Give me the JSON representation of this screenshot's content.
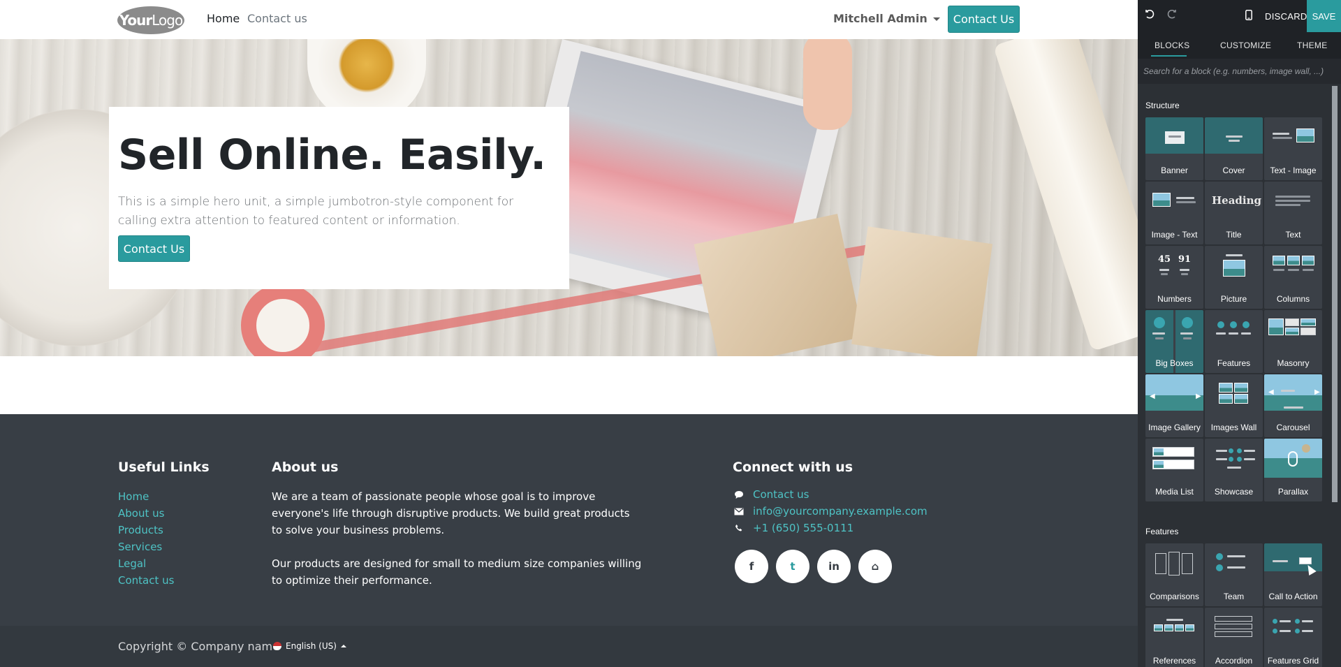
{
  "header": {
    "logo_text_bold": "Your",
    "logo_text_light": "Logo",
    "nav": [
      "Home",
      "Contact us"
    ],
    "user_name": "Mitchell Admin",
    "cta_label": "Contact Us"
  },
  "hero": {
    "title": "Sell Online. Easily.",
    "text": "This is a simple hero unit, a simple jumbotron-style component for calling extra attention to featured content or information.",
    "button_label": "Contact Us"
  },
  "footer": {
    "links_heading": "Useful Links",
    "links": [
      "Home",
      "About us",
      "Products",
      "Services",
      "Legal",
      "Contact us"
    ],
    "about_heading": "About us",
    "about_p1": "We are a team of passionate people whose goal is to improve everyone's life through disruptive products. We build great products to solve your business problems.",
    "about_p2": "Our products are designed for small to medium size companies willing to optimize their performance.",
    "connect_heading": "Connect with us",
    "contacts": [
      "Contact us",
      "info@yourcompany.example.com",
      "+1 (650) 555-0111"
    ],
    "contact_icons": [
      "comment-icon",
      "envelope-icon",
      "phone-icon"
    ],
    "social_icons": [
      "facebook-icon",
      "twitter-icon",
      "linkedin-icon",
      "home-icon"
    ],
    "social_glyphs": [
      "f",
      "t",
      "in",
      "⌂"
    ],
    "copyright": "Copyright © Company name",
    "language": "English (US)"
  },
  "editor": {
    "discard_label": "DISCARD",
    "save_label": "SAVE",
    "tabs": [
      "BLOCKS",
      "CUSTOMIZE",
      "THEME"
    ],
    "search_placeholder": "Search for a block (e.g. numbers, image wall, ...)",
    "structure_title": "Structure",
    "structure_blocks": [
      "Banner",
      "Cover",
      "Text - Image",
      "Image - Text",
      "Title",
      "Text",
      "Numbers",
      "Picture",
      "Columns",
      "Big Boxes",
      "Features",
      "Masonry",
      "Image Gallery",
      "Images Wall",
      "Carousel",
      "Media List",
      "Showcase",
      "Parallax"
    ],
    "features_title": "Features",
    "features_blocks": [
      "Comparisons",
      "Team",
      "Call to Action",
      "References",
      "Accordion",
      "Features Grid"
    ],
    "heading_thumb_text": "Heading",
    "numbers_thumb_text": [
      "45",
      "91"
    ]
  },
  "colors": {
    "accent": "#2a9b9e",
    "footer_bg": "#383e45",
    "editor_bg": "#2c3035",
    "link": "#4ec3c5"
  }
}
